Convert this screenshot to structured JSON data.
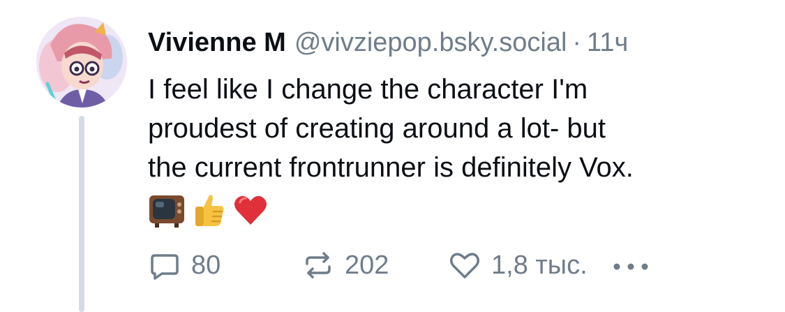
{
  "post": {
    "author": {
      "display_name": "Vivienne M",
      "handle": "@vivziepop.bsky.social",
      "separator": "·",
      "timestamp": "11ч"
    },
    "text_lines": [
      "I feel like I change the character I'm",
      "proudest of creating around a lot- but",
      "the current frontrunner is definitely Vox."
    ],
    "emojis": [
      "television",
      "thumbs-up",
      "red-heart"
    ],
    "actions": {
      "reply_count": "80",
      "repost_count": "202",
      "like_count": "1,8 тыс."
    }
  },
  "icons": {
    "reply": "reply-icon",
    "repost": "repost-icon",
    "like": "heart-icon",
    "more": "more-dots-icon"
  },
  "colors": {
    "text_primary": "#0b0f14",
    "text_secondary": "#6f7c8a",
    "thread_line": "#d4dbe2",
    "heart_emoji": "#e0303a",
    "thumbs_emoji": "#f6c242"
  }
}
